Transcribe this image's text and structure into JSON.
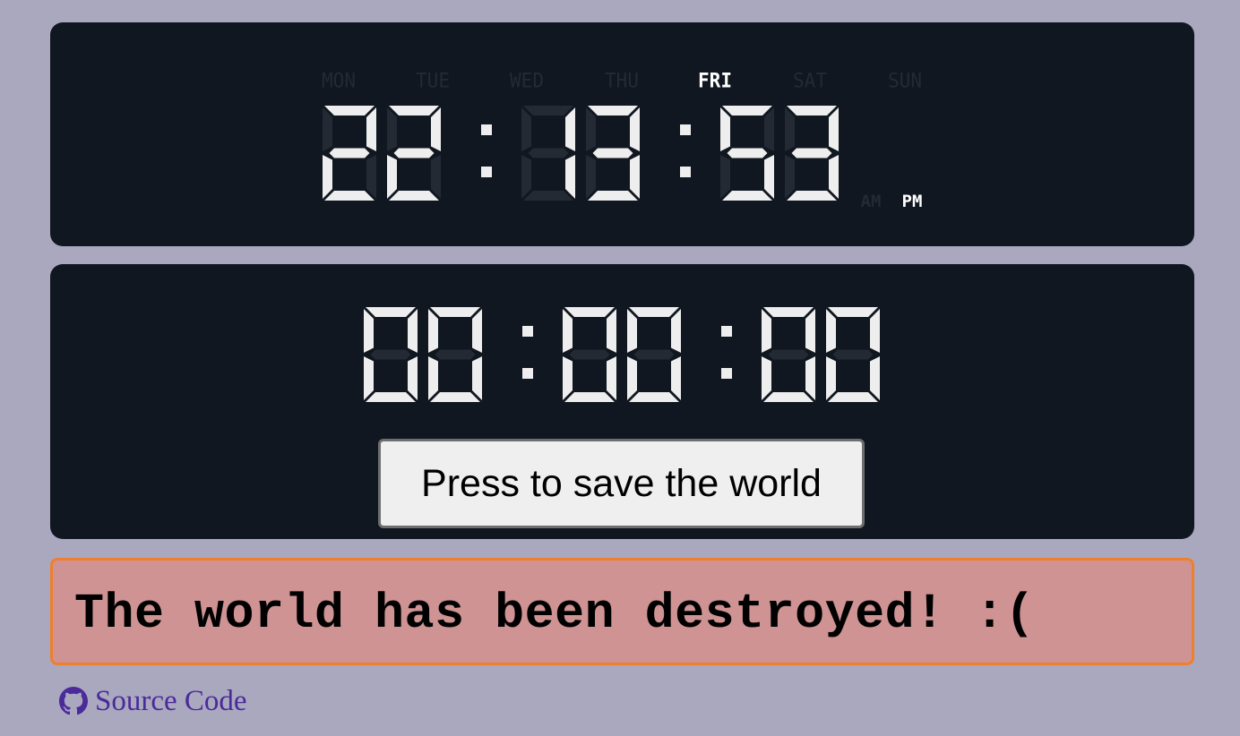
{
  "clock": {
    "days": [
      "MON",
      "TUE",
      "WED",
      "THU",
      "FRI",
      "SAT",
      "SUN"
    ],
    "active_day": "FRI",
    "time": "22:13:53",
    "meridiem": [
      "AM",
      "PM"
    ],
    "active_meridiem": "PM"
  },
  "timer": {
    "time": "00:00:00",
    "button_label": "Press to save the world"
  },
  "message": "The world has been destroyed! :(",
  "footer": {
    "link_label": "Source Code",
    "icon": "github-icon"
  },
  "colors": {
    "background": "#a9a8bf",
    "panel": "#101720",
    "segment_on": "#eeeeee",
    "segment_off": "#232a33",
    "message_bg": "#cf9393",
    "message_border": "#f07f2d",
    "link": "#4b2a9a"
  }
}
